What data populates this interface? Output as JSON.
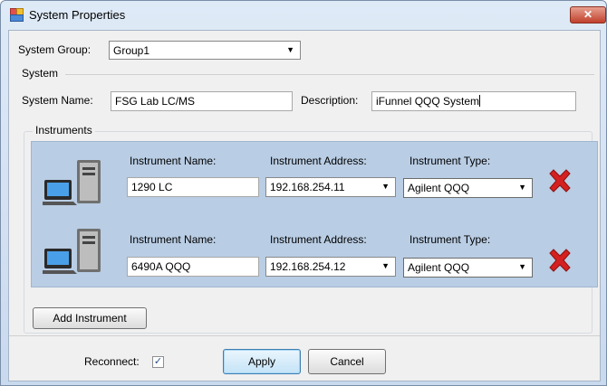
{
  "window": {
    "title": "System Properties",
    "close_label": "✕"
  },
  "system_group": {
    "label": "System Group:",
    "value": "Group1"
  },
  "system_section": {
    "title": "System",
    "name_label": "System Name:",
    "name_value": "FSG Lab  LC/MS",
    "description_label": "Description:",
    "description_value": "iFunnel QQQ System"
  },
  "instruments": {
    "title": "Instruments",
    "rows": [
      {
        "name_label": "Instrument Name:",
        "name_value": "1290 LC",
        "address_label": "Instrument Address:",
        "address_value": "192.168.254.11",
        "type_label": "Instrument Type:",
        "type_value": "Agilent QQQ"
      },
      {
        "name_label": "Instrument Name:",
        "name_value": "6490A QQQ",
        "address_label": "Instrument Address:",
        "address_value": "192.168.254.12",
        "type_label": "Instrument Type:",
        "type_value": "Agilent QQQ"
      }
    ],
    "add_button": "Add Instrument"
  },
  "footer": {
    "reconnect_label": "Reconnect:",
    "reconnect_checked": true,
    "check_mark": "✓",
    "apply": "Apply",
    "cancel": "Cancel"
  },
  "icons": {
    "dropdown": "chevron-down-icon",
    "computer": "computer-icon",
    "delete": "delete-x-icon"
  },
  "colors": {
    "instrument_panel": "#b9cde4",
    "delete_red": "#d42020"
  }
}
